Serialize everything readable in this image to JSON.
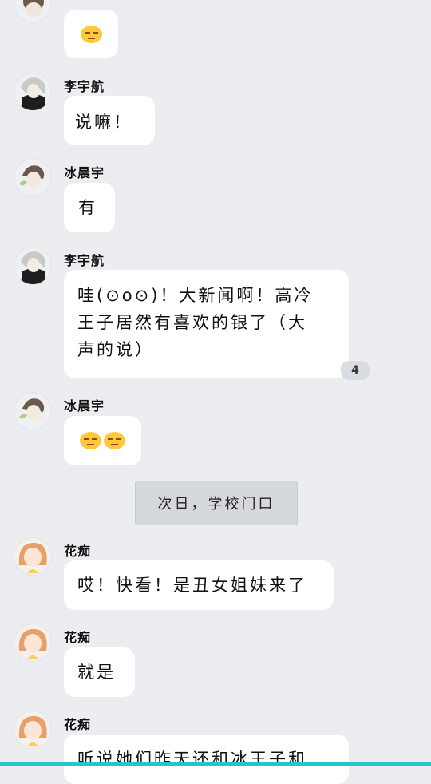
{
  "messages": [
    {
      "type": "emoji",
      "sender": "冰晨宇",
      "text": "😣"
    },
    {
      "type": "text",
      "sender": "李宇航",
      "text": "说嘛！"
    },
    {
      "type": "text",
      "sender": "冰晨宇",
      "text": "有"
    },
    {
      "type": "text",
      "sender": "李宇航",
      "lines": [
        "哇(⊙o⊙)！大新闻啊！高冷",
        "王子居然有喜欢的银了（大",
        "声的说）"
      ],
      "badge": "4"
    },
    {
      "type": "emoji",
      "sender": "冰晨宇",
      "text": "😒😒"
    },
    {
      "type": "system",
      "text": "次日，学校门口"
    },
    {
      "type": "text",
      "sender": "花痴",
      "text": "哎！快看！是丑女姐妹来了"
    },
    {
      "type": "text",
      "sender": "花痴",
      "text": "就是"
    },
    {
      "type": "text",
      "sender": "花痴",
      "text": "听说她们昨天还和冰王子和"
    }
  ],
  "colors": {
    "background": "#ebedf0",
    "bubble": "#ffffff",
    "bottom_bar": "#23c7c8",
    "system_pill": "#d5d9de"
  }
}
